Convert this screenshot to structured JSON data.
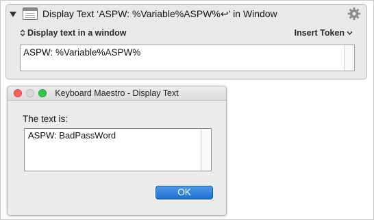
{
  "action": {
    "title": "Display Text ‘ASPW: %Variable%ASPW%↩’ in Window",
    "mode_label": "Display text in a window",
    "insert_token_label": "Insert Token",
    "text_value": "ASPW: %Variable%ASPW%"
  },
  "dialog": {
    "title": "Keyboard Maestro - Display Text",
    "prompt": "The text is:",
    "result_text": "ASPW: BadPassWord",
    "ok_label": "OK"
  },
  "colors": {
    "accent": "#1d6fd0",
    "close": "#fc605c",
    "zoom": "#34c84a"
  }
}
